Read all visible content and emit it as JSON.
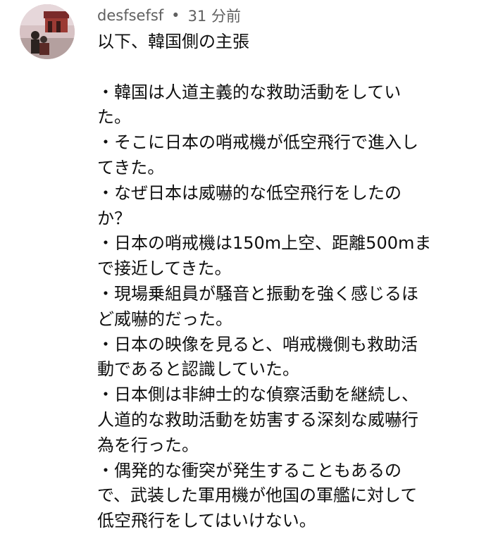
{
  "comment": {
    "author": "desfsefsf",
    "separator": "•",
    "time": "31 分前",
    "avatar_icon": "profile-photo-avatar",
    "lines": [
      "以下、韓国側の主張",
      "",
      "・韓国は人道主義的な救助活動をしてい",
      "た。",
      "・そこに日本の哨戒機が低空飛行で進入し",
      "てきた。",
      "・なぜ日本は威嚇的な低空飛行をしたの",
      "か？",
      "・日本の哨戒機は150m上空、距離500mま",
      "で接近してきた。",
      "・現場乗組員が騒音と振動を強く感じるほ",
      "ど威嚇的だった。",
      "・日本の映像を見ると、哨戒機側も救助活",
      "動であると認識していた。",
      "・日本側は非紳士的な偵察活動を継続し、",
      "人道的な救助活動を妨害する深刻な威嚇行",
      "為を行った。",
      "・偶発的な衝突が発生することもあるの",
      "で、武装した軍用機が他国の軍艦に対して",
      "低空飛行をしてはいけない。"
    ]
  }
}
